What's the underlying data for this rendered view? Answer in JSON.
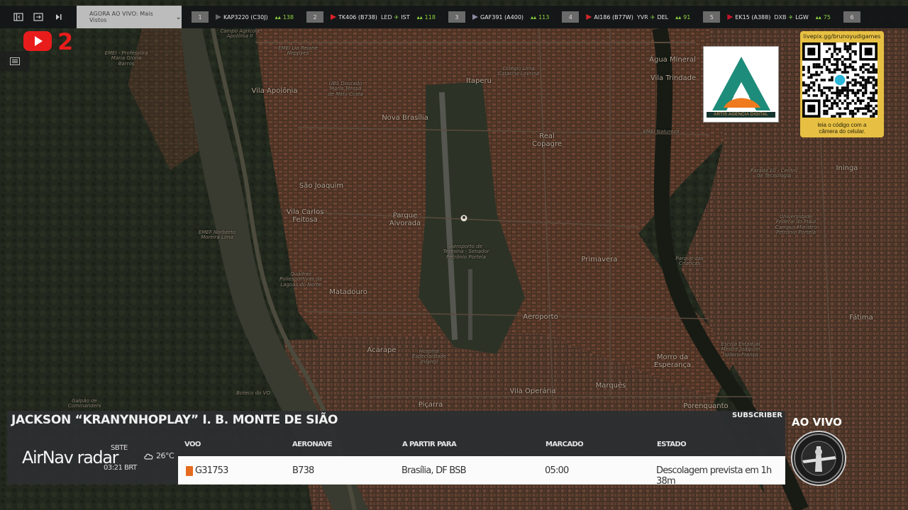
{
  "topbar": {
    "live_label": "AGORA AO VIVO: Mais Vistos",
    "flights": [
      {
        "num": "1",
        "callsign": "KAP3220 (C30J)",
        "route_from": "",
        "route_to": "",
        "count": "138",
        "logo_color": "#666666"
      },
      {
        "num": "2",
        "callsign": "TK406 (B738)",
        "route_from": "LED",
        "route_to": "IST",
        "count": "118",
        "logo_color": "#e0202a"
      },
      {
        "num": "3",
        "callsign": "GAF391 (A400)",
        "route_from": "",
        "route_to": "",
        "count": "113",
        "logo_color": "#8a8aa0"
      },
      {
        "num": "4",
        "callsign": "AI186 (B77W)",
        "route_from": "YVR",
        "route_to": "DEL",
        "count": "91",
        "logo_color": "#d2262a"
      },
      {
        "num": "5",
        "callsign": "EK15 (A388)",
        "route_from": "DXB",
        "route_to": "LGW",
        "count": "75",
        "logo_color": "#c4152a"
      },
      {
        "num": "6",
        "callsign": "",
        "route_from": "",
        "route_to": "",
        "count": "",
        "logo_color": "#666666"
      }
    ]
  },
  "youtube": {
    "number": "2"
  },
  "sponsor": {
    "caption": "ARTIS AGENCIA DIGITAL"
  },
  "qr": {
    "url": "livepix.gg/brunoyudigames",
    "caption_line1": "leia o código com a",
    "caption_line2": "câmera do celular."
  },
  "map_labels": [
    {
      "text": "Campo Agrícola\nApolônia II",
      "size": "small"
    },
    {
      "text": "EMEI - Professora\nMaria Glória\nBarros",
      "size": "small"
    },
    {
      "text": "EMEI Lia Rejane\nNeppyes",
      "size": "small"
    },
    {
      "text": "Vila Apolônia",
      "size": "big"
    },
    {
      "text": "UBS Dourado\nMaria Teresa\nde Melo Costa",
      "size": "small"
    },
    {
      "text": "Itaperu",
      "size": "big"
    },
    {
      "text": "Nova Brasília",
      "size": "big"
    },
    {
      "text": "Colégio Lima\nCatarino Levrina",
      "size": "small"
    },
    {
      "text": "Água Mineral",
      "size": "big"
    },
    {
      "text": "Vila Trindade",
      "size": "big"
    },
    {
      "text": "Real\nCopagre",
      "size": "big"
    },
    {
      "text": "EMEI Natureza",
      "size": "small"
    },
    {
      "text": "São Joaquim",
      "size": "big"
    },
    {
      "text": "Vila Carlos\nFeitosa",
      "size": "big"
    },
    {
      "text": "Parque\nAlvorada",
      "size": "big"
    },
    {
      "text": "Aeroporto de\nTeresina - Senador\nPetrônio Portela",
      "size": "small"
    },
    {
      "text": "EMEF Norberto\nMoreira Lima",
      "size": "small"
    },
    {
      "text": "Primavera",
      "size": "big"
    },
    {
      "text": "Parque das\nCrianças",
      "size": "small"
    },
    {
      "text": "Universidade\nFederal do Piauí\nCampus Ministro\nPetrônio Portela",
      "size": "small"
    },
    {
      "text": "Ininga",
      "size": "big"
    },
    {
      "text": "Quadras\nPoliesportivas da\nLagoas do Norte",
      "size": "small"
    },
    {
      "text": "Matadouro",
      "size": "big"
    },
    {
      "text": "Aeroporto",
      "size": "big"
    },
    {
      "text": "Fátima",
      "size": "big"
    },
    {
      "text": "Acarape",
      "size": "big"
    },
    {
      "text": "Hospital\nEspecialidade\nInfantil",
      "size": "small"
    },
    {
      "text": "Morro da\nEsperança",
      "size": "big"
    },
    {
      "text": "Vila Operária",
      "size": "big"
    },
    {
      "text": "Marquês",
      "size": "big"
    },
    {
      "text": "Piçarra",
      "size": "big"
    },
    {
      "text": "Porenquanto",
      "size": "big"
    },
    {
      "text": "Boteco do VO",
      "size": "small"
    },
    {
      "text": "Escola Estadual\nMestre Joaquim\nIsidoro França",
      "size": "small"
    },
    {
      "text": "Parada 10 - Centro\nde Tecnologia",
      "size": "small"
    },
    {
      "text": "Galpão de\nCommanders",
      "size": "small"
    }
  ],
  "panel": {
    "streamer": "JACKSON “KRANYNHOPLAY” I. B. MONTE DE SIÃO",
    "subscriber": "SUBSCRIBER",
    "brand_air": "AirNav",
    "brand_radar": "radar",
    "airport": "SBTE",
    "localtime": "03:21 BRT",
    "weather": "26°C",
    "columns": [
      "VOO",
      "AERONAVE",
      "A PARTIR PARA",
      "MARCADO",
      "ESTADO"
    ],
    "row": {
      "flight": "G31753",
      "aircraft": "B738",
      "destination": "Brasília, DF BSB",
      "scheduled": "05:00",
      "status": "Descolagem prevista em 1h 38m"
    }
  },
  "aovivo": "AO VIVO",
  "colors": {
    "brand_red": "#e91c1c",
    "qr_gold": "#e7c043",
    "panel_bg": "#2c2e30",
    "signal_green": "#8fd43f"
  }
}
